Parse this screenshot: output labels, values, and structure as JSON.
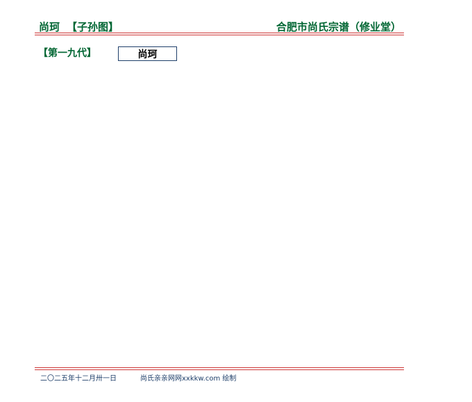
{
  "header": {
    "person_name": "尚珂",
    "chart_title": "【子孙图】",
    "genealogy_title": "合肥市尚氏宗谱（修业堂）"
  },
  "tree": {
    "generation_label": "【第一九代】",
    "persons": [
      {
        "name": "尚珂"
      }
    ]
  },
  "footer": {
    "date": "二〇二五年十二月卅一日",
    "credit": "尚氏亲亲网网xxkkw.com 绘制"
  },
  "colors": {
    "title_green": "#006633",
    "rule_red": "#cc3333",
    "box_border": "#1f3f6a",
    "footer_text": "#1f3f6a"
  }
}
